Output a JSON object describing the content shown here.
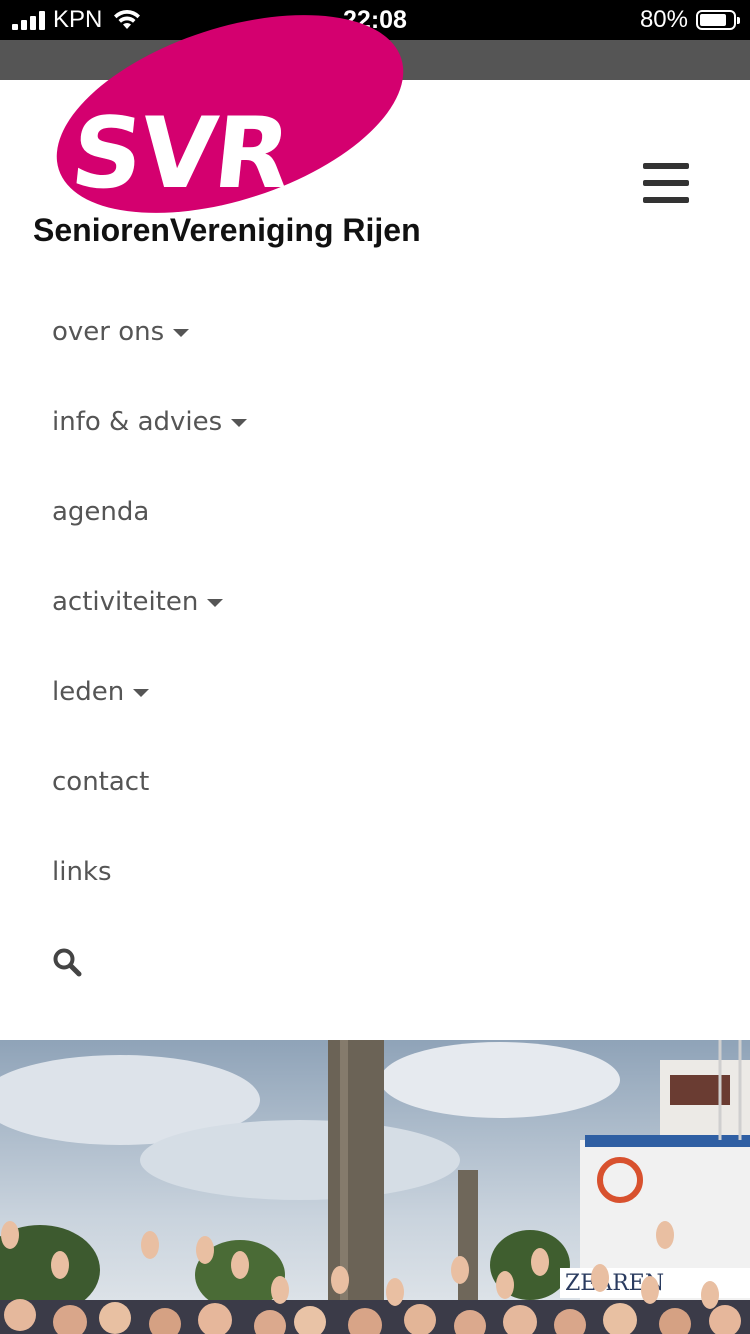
{
  "status_bar": {
    "carrier": "KPN",
    "time": "22:08",
    "battery": "80%",
    "battery_level": 0.8
  },
  "logo": {
    "mark": "SVR",
    "tagline": "SeniorenVereniging Rijen",
    "color": "#d4006f"
  },
  "menu": {
    "items": [
      {
        "label": "over ons"
      },
      {
        "label": "info & advies"
      },
      {
        "label": "agenda"
      },
      {
        "label": "activiteiten"
      },
      {
        "label": "leden"
      },
      {
        "label": "contact"
      },
      {
        "label": "links"
      }
    ],
    "search_icon": "search-icon"
  },
  "hero": {
    "subject": "group of seniors waving in front of a boat",
    "boat_text": "ZEAREN"
  }
}
